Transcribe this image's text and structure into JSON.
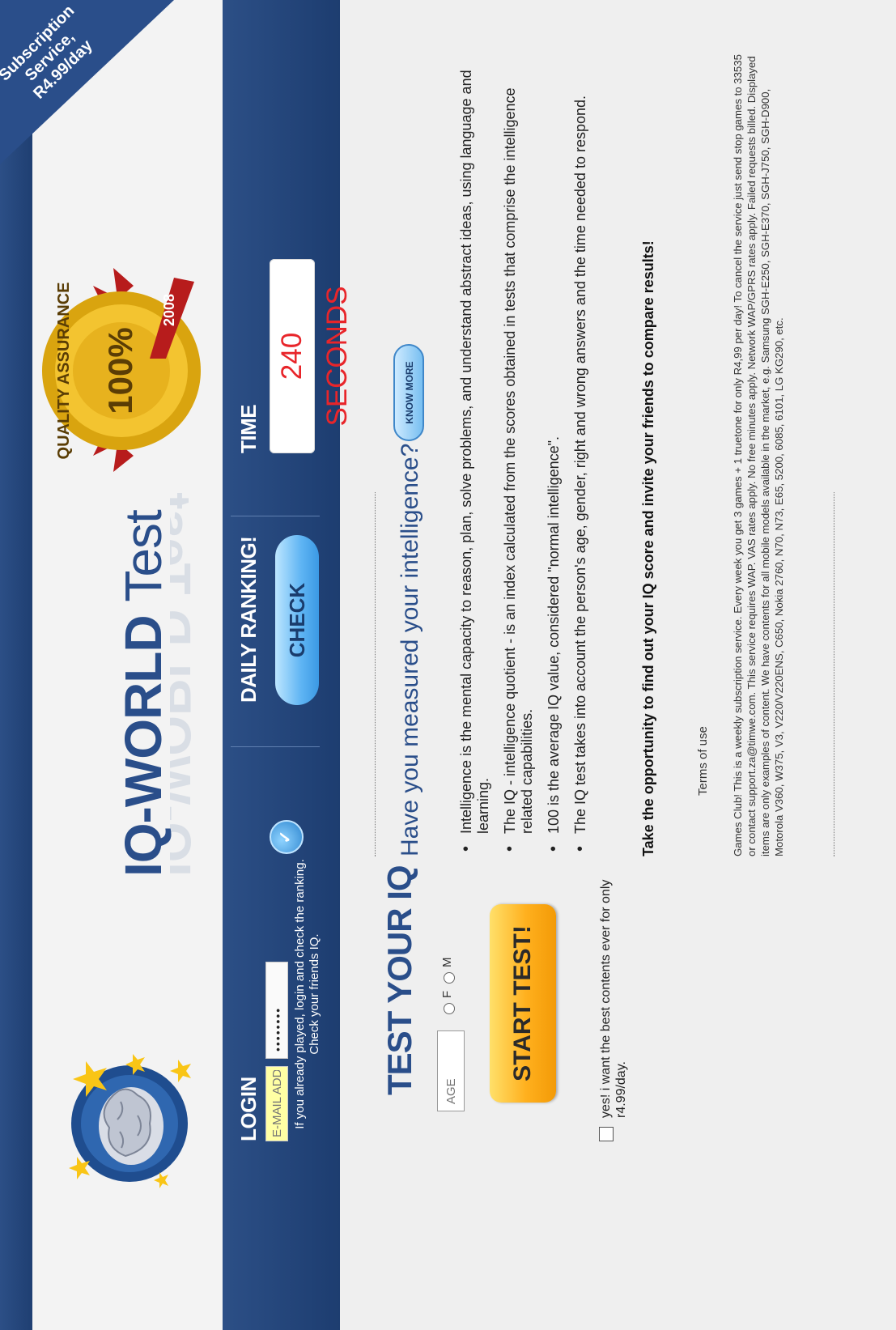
{
  "banner": {
    "ribbon_text": "Subscription Service, R4.99/day",
    "brand_bold": "IQ-WORLD",
    "brand_light": "Test",
    "seal_text": "QUALITY ASSURANCE",
    "seal_percent": "100%",
    "seal_year": "2008"
  },
  "login": {
    "heading": "LOGIN",
    "email_placeholder": "E-MAIL ADDRESS",
    "password_value": "••••••••",
    "note": "If you already played, login and check the ranking. Check your friends IQ."
  },
  "ranking": {
    "heading": "DAILY RANKING!",
    "button_label": "CHECK"
  },
  "timer": {
    "heading": "TIME",
    "value": "240 SECONDS"
  },
  "test": {
    "title": "TEST YOUR IQ",
    "age_placeholder": "AGE",
    "gender_f": "F",
    "gender_m": "M",
    "start_label": "START TEST!",
    "optin_text": "yes! i want the best contents ever for only r4.99/day."
  },
  "info": {
    "question": "Have you measured your intelligence?",
    "know_more_label": "KNOW MORE",
    "bullets": [
      "Intelligence is the mental capacity to reason, plan, solve problems, and understand abstract ideas, using language and learning.",
      "The IQ - intelligence quotient - is an index calculated from the scores obtained in tests that comprise the intelligence related capabilities.",
      "100 is the average IQ value, considered \"normal intelligence\".",
      "The IQ test takes into account the person's age, gender, right and wrong answers and the time needed to respond."
    ],
    "cta": "Take the opportunity to find out your IQ score and invite your friends to compare results!",
    "terms_label": "Terms of use",
    "disclaimer": "Games Club! This is a weekly subscription service. Every week you get 3 games + 1 truetone for only R4,99 per day! To cancel the service just send stop games to 33535 or contact support.za@timwe.com. This service requires WAP. VAS rates apply. No free minutes apply. Network WAP/GPRS rates apply. Failed requests billed. Displayed items are only examples of content. We have contents for all mobile models available in the market, e.g. Samsung SGH-E250, SGH-E370, SGH-J750, SGH-D900, Motorola V360, W375, V3, V220/V220ENS, C650, Nokia 2760, N70, N73, E65, 5200, 6085, 6101, LG KG290, etc."
  },
  "colors": {
    "brand_blue": "#2a4e8a",
    "time_red": "#e8252a",
    "start_orange": "#ffb01e",
    "email_yellow": "#ffffa4"
  }
}
